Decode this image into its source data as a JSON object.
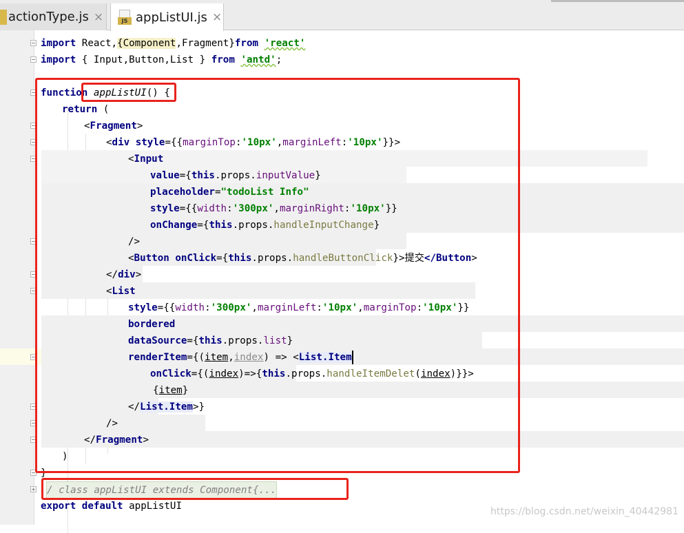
{
  "tabs": [
    {
      "label": "actionType.js",
      "close": "×",
      "active": false
    },
    {
      "label": "appListUI.js",
      "close": "×",
      "active": true,
      "badge": "JS"
    }
  ],
  "code": {
    "l1": {
      "kw1": "import",
      "a": " React,",
      "b": "{",
      "c": "Component",
      "d": ",Fragment}",
      "kw2": "from",
      "sp": " ",
      "s": "'react'"
    },
    "l2": {
      "kw1": "import",
      "a": " { Input,Button,List } ",
      "kw2": "from",
      "sp": " ",
      "s": "'antd'",
      "semi": ";"
    },
    "l4": {
      "kw": "function",
      "sp": " ",
      "fn": "appListUI",
      "rest": "() {"
    },
    "l5": {
      "kw": "return",
      "rest": " ("
    },
    "l6": {
      "open": "<",
      "tag": "Fragment",
      "close": ">"
    },
    "l7": {
      "open": "<",
      "tag": "div",
      "sp": " ",
      "attr": "style",
      "eq": "={{",
      "p1": "marginTop",
      "c1": ":",
      "s1": "'10px'",
      "cm": ",",
      "p2": "marginLeft",
      "c2": ":",
      "s2": "'10px'",
      "end": "}}>"
    },
    "l8": {
      "open": "<",
      "tag": "Input"
    },
    "l9": {
      "attr": "value",
      "eq": "={",
      "this": "this",
      "dot": ".props.",
      "m": "inputValue",
      "end": "}"
    },
    "l10": {
      "attr": "placeholder",
      "eq": "=",
      "s": "\"todoList Info\""
    },
    "l11": {
      "attr": "style",
      "eq": "={{",
      "p1": "width",
      "c1": ":",
      "s1": "'300px'",
      "cm": ",",
      "p2": "marginRight",
      "c2": ":",
      "s2": "'10px'",
      "end": "}}"
    },
    "l12": {
      "attr": "onChange",
      "eq": "={",
      "this": "this",
      "dot": ".props.",
      "m": "handleInputChange",
      "end": "}"
    },
    "l13": {
      "text": "/>"
    },
    "l14": {
      "open": "<",
      "tag": "Button",
      "sp": " ",
      "attr": "onClick",
      "eq": "={",
      "this": "this",
      "dot": ".props.",
      "m": "handleButtonClick",
      "mid": "}>",
      "txt": "提交",
      "ctag": "</Button",
      "cend": ">"
    },
    "l15": {
      "open": "</",
      "tag": "div",
      "close": ">"
    },
    "l16": {
      "open": "<",
      "tag": "List"
    },
    "l17": {
      "attr": "style",
      "eq": "={{",
      "p1": "width",
      "c1": ":",
      "s1": "'300px'",
      "cm1": ",",
      "p2": "marginLeft",
      "c2": ":",
      "s2": "'10px'",
      "cm2": ",",
      "p3": "marginTop",
      "c3": ":",
      "s3": "'10px'",
      "end": "}}"
    },
    "l18": {
      "attr": "bordered"
    },
    "l19": {
      "attr": "dataSource",
      "eq": "={",
      "this": "this",
      "dot": ".props.",
      "m": "list",
      "end": "}"
    },
    "l20": {
      "attr": "renderItem",
      "eq": "={(",
      "a1": "item",
      "cm": ",",
      "a2": "index",
      "arrow": ") => ",
      "lt": "<",
      "tag": "List.Item"
    },
    "l21": {
      "attr": "onClick",
      "eq": "={(",
      "a": "index",
      "arrow": ")=>{",
      "this": "this",
      "dot": ".props.",
      "m": "handleItemDelet",
      "lp": "(",
      "a2": "index",
      "end": ")}}>"
    },
    "l22": {
      "lb": "{",
      "a": "item",
      "rb": "}"
    },
    "l23": {
      "open": "</",
      "tag": "List.Item",
      "close": ">}"
    },
    "l24": {
      "text": "/>"
    },
    "l25": {
      "open": "</",
      "tag": "Fragment",
      "close": ">"
    },
    "l26": {
      "text": ")"
    },
    "l27": {
      "text": "}"
    },
    "l28": {
      "comment": "/ class appListUI extends Component{..."
    },
    "l29": {
      "kw1": "export",
      "sp": " ",
      "kw2": "default",
      "rest": " appListUI"
    }
  },
  "watermark": "https://blog.csdn.net/weixin_40442981",
  "colors": {
    "annotation_box": "#e8231c",
    "keyword": "#000080",
    "string": "#008000",
    "member": "#660e7a"
  }
}
